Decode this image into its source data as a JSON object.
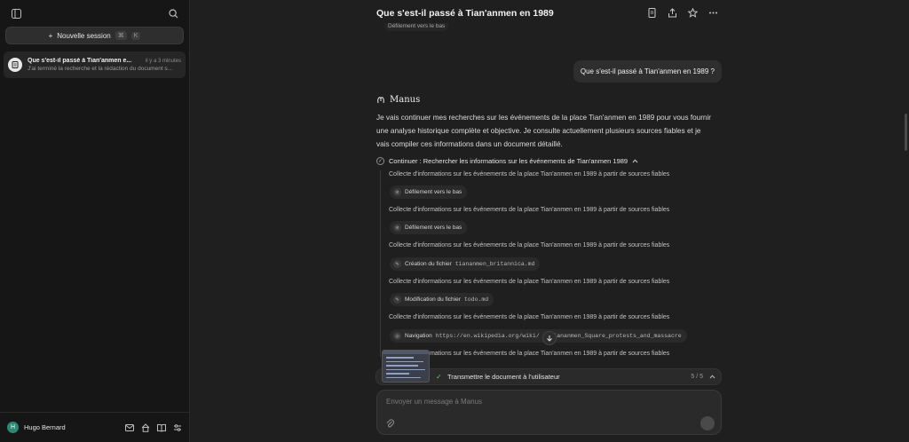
{
  "sidebar": {
    "new_session_label": "Nouvelle session",
    "shortcut_cmd": "⌘",
    "shortcut_key": "K",
    "session": {
      "title": "Que s'est-il passé à Tian'anmen e...",
      "time": "il y a 3 minutes",
      "subtitle": "J'ai terminé la recherche et la rédaction du document s..."
    },
    "user": {
      "initial": "H",
      "name": "Hugo Bernard"
    }
  },
  "header": {
    "title": "Que s'est-il passé à Tian'anmen en 1989"
  },
  "chat": {
    "partial_chip": "Défilement vers le bas",
    "user_message": "Que s'est-il passé à Tian'anmen en 1989 ?",
    "agent_name": "Manus",
    "agent_text": "Je vais continuer mes recherches sur les événements de la place Tian'anmen en 1989 pour vous fournir une analyse historique complète et objective. Je consulte actuellement plusieurs sources fiables et je vais compiler ces informations dans un document détaillé.",
    "step_title": "Continuer : Rechercher les informations sur les événements de Tian'anmen 1989",
    "steps": [
      {
        "text": "Collecte d'informations sur les événements de la place Tian'anmen en 1989 à partir de sources fiables",
        "tool": "Défilement vers le bas",
        "arg": ""
      },
      {
        "text": "Collecte d'informations sur les événements de la place Tian'anmen en 1989 à partir de sources fiables",
        "tool": "Défilement vers le bas",
        "arg": ""
      },
      {
        "text": "Collecte d'informations sur les événements de la place Tian'anmen en 1989 à partir de sources fiables",
        "tool": "Création du fichier",
        "arg": "tiananmen_britannica.md"
      },
      {
        "text": "Collecte d'informations sur les événements de la place Tian'anmen en 1989 à partir de sources fiables",
        "tool": "Modification du fichier",
        "arg": "todo.md"
      },
      {
        "text": "Collecte d'informations sur les événements de la place Tian'anmen en 1989 à partir de sources fiables",
        "tool": "Navigation",
        "arg": "https://en.wikipedia.org/wiki/   Tiananmen_Square_protests_and_massacre"
      },
      {
        "text": "Collecte d'informations sur les événements de la place Tian'anmen en 1989 à partir de sources fiables",
        "tool": "",
        "arg": ""
      }
    ],
    "progress": {
      "label": "Transmettre le document à l'utilisateur",
      "count": "5 / 5"
    },
    "composer_placeholder": "Envoyer un message à Manus"
  }
}
